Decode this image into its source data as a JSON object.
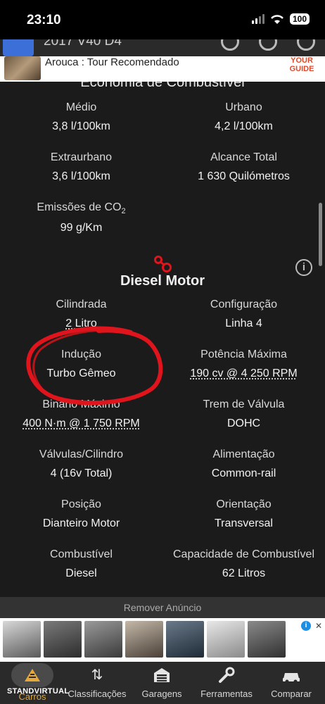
{
  "status_bar": {
    "time": "23:10",
    "battery": "100"
  },
  "app_bar": {
    "title": "2017 V40 D4"
  },
  "top_ad": {
    "text": "Arouca : Tour Recomendado",
    "brand": "YOUR GUIDE"
  },
  "fuel_economy": {
    "title": "Economia de Combustível",
    "items": [
      {
        "label": "Médio",
        "value": "3,8 l/100km"
      },
      {
        "label": "Urbano",
        "value": "4,2 l/100km"
      },
      {
        "label": "Extraurbano",
        "value": "3,6 l/100km"
      },
      {
        "label": "Alcance Total",
        "value": "1 630 Quilómetros"
      },
      {
        "label": "Emissões de CO",
        "label_sub": "2",
        "value": "99 g/Km"
      }
    ]
  },
  "engine": {
    "title": "Diesel Motor",
    "items": [
      {
        "label": "Cilindrada",
        "value": "2 Litro"
      },
      {
        "label": "Configuração",
        "value": "Linha 4"
      },
      {
        "label": "Indução",
        "value": "Turbo Gêmeo"
      },
      {
        "label": "Potência Máxima",
        "value": "190 cv @ 4 250 RPM"
      },
      {
        "label": "Binário Máximo",
        "value": "400 N·m @ 1 750 RPM"
      },
      {
        "label": "Trem de Válvula",
        "value": "DOHC"
      },
      {
        "label": "Válvulas/Cilindro",
        "value": "4 (16v Total)"
      },
      {
        "label": "Alimentação",
        "value": "Common-rail"
      },
      {
        "label": "Posição",
        "value": "Dianteiro Motor"
      },
      {
        "label": "Orientação",
        "value": "Transversal"
      },
      {
        "label": "Combustível",
        "value": "Diesel"
      },
      {
        "label": "Capacidade de Combustível",
        "value": "62 Litros"
      }
    ]
  },
  "remove_ad": "Remover Anúncio",
  "tabs": [
    {
      "label": "Carros",
      "icon": "car-logo-icon"
    },
    {
      "label": "Classificações",
      "icon": "sort-arrows-icon"
    },
    {
      "label": "Garagens",
      "icon": "garage-icon"
    },
    {
      "label": "Ferramentas",
      "icon": "wrench-icon"
    },
    {
      "label": "Comparar",
      "icon": "compare-cars-icon"
    }
  ],
  "watermark": "STANDVIRTUAL",
  "colors": {
    "annotation_red": "#e0141c",
    "background": "#1b1b1b",
    "accent_gold": "#e3a73a"
  }
}
